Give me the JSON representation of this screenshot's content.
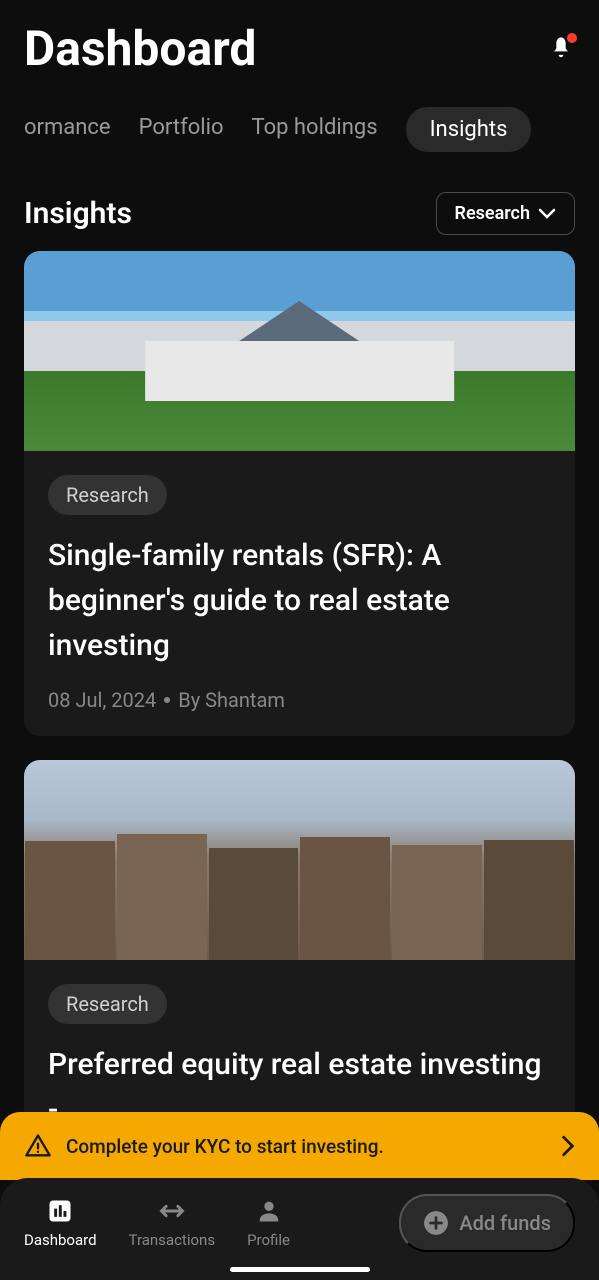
{
  "header": {
    "title": "Dashboard"
  },
  "tabs": {
    "items": [
      {
        "label": "ormance",
        "active": false
      },
      {
        "label": "Portfolio",
        "active": false
      },
      {
        "label": "Top holdings",
        "active": false
      },
      {
        "label": "Insights",
        "active": true
      }
    ]
  },
  "section": {
    "title": "Insights",
    "filter_label": "Research"
  },
  "articles": [
    {
      "tag": "Research",
      "title": "Single-family rentals (SFR): A beginner's guide to real estate investing",
      "date": "08 Jul, 2024",
      "author": "By Shantam"
    },
    {
      "tag": "Research",
      "title": "Preferred equity real estate investing -",
      "date": "",
      "author": ""
    }
  ],
  "kyc_banner": {
    "text": "Complete your KYC to start investing."
  },
  "bottom_nav": {
    "items": [
      {
        "label": "Dashboard",
        "active": true
      },
      {
        "label": "Transactions",
        "active": false
      },
      {
        "label": "Profile",
        "active": false
      }
    ],
    "add_funds_label": "Add funds"
  }
}
